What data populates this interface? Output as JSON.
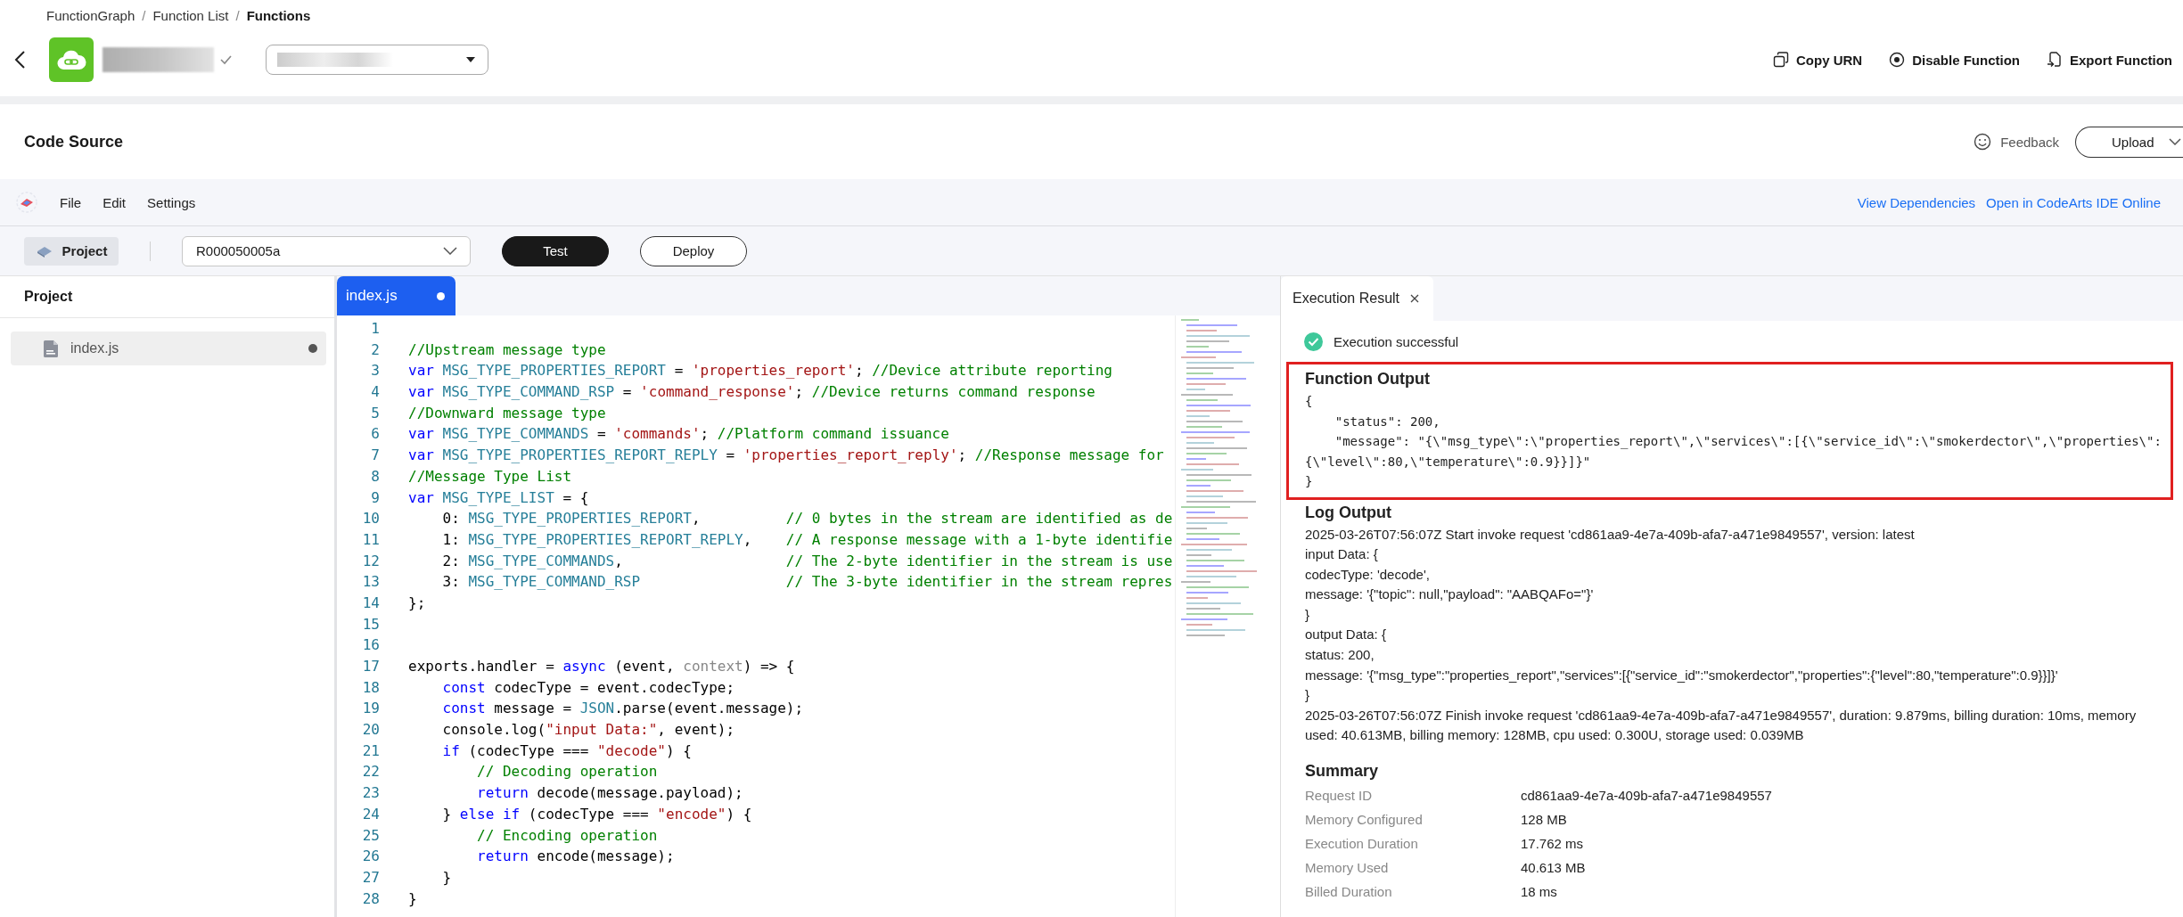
{
  "breadcrumb": {
    "items": [
      {
        "label": "FunctionGraph",
        "current": false
      },
      {
        "label": "Function List",
        "current": false
      },
      {
        "label": "Functions",
        "current": true
      }
    ],
    "separators": [
      "/",
      "/"
    ]
  },
  "header": {
    "actions": [
      {
        "label": "Copy URN"
      },
      {
        "label": "Disable Function"
      },
      {
        "label": "Export Function"
      }
    ]
  },
  "code_source": {
    "title": "Code Source",
    "feedback": "Feedback",
    "upload": "Upload"
  },
  "ide_menu": {
    "items": [
      "File",
      "Edit",
      "Settings"
    ],
    "links": [
      "View Dependencies",
      "Open in CodeArts IDE Online"
    ]
  },
  "toolbar": {
    "project_button": "Project",
    "select_value": "R000050005a",
    "buttons": [
      {
        "label": "Test",
        "kind": "primary"
      },
      {
        "label": "Deploy",
        "kind": "secondary"
      }
    ]
  },
  "project_panel": {
    "title": "Project",
    "files": [
      {
        "name": "index.js",
        "modified": true,
        "selected": true
      }
    ]
  },
  "editor": {
    "tabs": [
      {
        "label": "index.js",
        "modified": true,
        "selected": true
      }
    ],
    "lines": [
      {
        "number": "1"
      },
      {
        "number": "2",
        "tokens": [
          {
            "kind": "comment",
            "text": "//Upstream message type"
          }
        ]
      },
      {
        "number": "3",
        "tokens": [
          {
            "kind": "keyword",
            "text": "var"
          },
          {
            "kind": "constant",
            "text": " MSG_TYPE_PROPERTIES_REPORT"
          },
          {
            "kind": "plain",
            "text": " = "
          },
          {
            "kind": "string",
            "text": "'properties_report'"
          },
          {
            "kind": "plain",
            "text": "; "
          },
          {
            "kind": "comment",
            "text": "//Device attribute reporting"
          }
        ]
      },
      {
        "number": "4",
        "tokens": [
          {
            "kind": "keyword",
            "text": "var"
          },
          {
            "kind": "constant",
            "text": " MSG_TYPE_COMMAND_RSP"
          },
          {
            "kind": "plain",
            "text": " = "
          },
          {
            "kind": "string",
            "text": "'command_response'"
          },
          {
            "kind": "plain",
            "text": "; "
          },
          {
            "kind": "comment",
            "text": "//Device returns command response"
          }
        ]
      },
      {
        "number": "5",
        "tokens": [
          {
            "kind": "comment",
            "text": "//Downward message type"
          }
        ]
      },
      {
        "number": "6",
        "tokens": [
          {
            "kind": "keyword",
            "text": "var"
          },
          {
            "kind": "constant",
            "text": " MSG_TYPE_COMMANDS"
          },
          {
            "kind": "plain",
            "text": " = "
          },
          {
            "kind": "string",
            "text": "'commands'"
          },
          {
            "kind": "plain",
            "text": "; "
          },
          {
            "kind": "comment",
            "text": "//Platform command issuance"
          }
        ]
      },
      {
        "number": "7",
        "tokens": [
          {
            "kind": "keyword",
            "text": "var"
          },
          {
            "kind": "constant",
            "text": " MSG_TYPE_PROPERTIES_REPORT_REPLY"
          },
          {
            "kind": "plain",
            "text": " = "
          },
          {
            "kind": "string",
            "text": "'properties_report_reply'"
          },
          {
            "kind": "plain",
            "text": "; "
          },
          {
            "kind": "comment",
            "text": "//Response message for"
          }
        ]
      },
      {
        "number": "8",
        "tokens": [
          {
            "kind": "comment",
            "text": "//Message Type List"
          }
        ]
      },
      {
        "number": "9",
        "tokens": [
          {
            "kind": "keyword",
            "text": "var"
          },
          {
            "kind": "constant",
            "text": " MSG_TYPE_LIST"
          },
          {
            "kind": "plain",
            "text": " = {"
          }
        ]
      },
      {
        "number": "10",
        "tokens": [
          {
            "kind": "plain",
            "text": "    0: "
          },
          {
            "kind": "constant",
            "text": "MSG_TYPE_PROPERTIES_REPORT"
          },
          {
            "kind": "plain",
            "text": ",          "
          },
          {
            "kind": "comment",
            "text": "// 0 bytes in the stream are identified as de"
          }
        ]
      },
      {
        "number": "11",
        "tokens": [
          {
            "kind": "plain",
            "text": "    1: "
          },
          {
            "kind": "constant",
            "text": "MSG_TYPE_PROPERTIES_REPORT_REPLY"
          },
          {
            "kind": "plain",
            "text": ",    "
          },
          {
            "kind": "comment",
            "text": "// A response message with a 1-byte identifie"
          }
        ]
      },
      {
        "number": "12",
        "tokens": [
          {
            "kind": "plain",
            "text": "    2: "
          },
          {
            "kind": "constant",
            "text": "MSG_TYPE_COMMANDS"
          },
          {
            "kind": "plain",
            "text": ",                   "
          },
          {
            "kind": "comment",
            "text": "// The 2-byte identifier in the stream is use"
          }
        ]
      },
      {
        "number": "13",
        "tokens": [
          {
            "kind": "plain",
            "text": "    3: "
          },
          {
            "kind": "constant",
            "text": "MSG_TYPE_COMMAND_RSP"
          },
          {
            "kind": "comment",
            "text": "                 // The 3-byte identifier in the stream repres"
          }
        ]
      },
      {
        "number": "14",
        "tokens": [
          {
            "kind": "plain",
            "text": "};"
          }
        ]
      },
      {
        "number": "15"
      },
      {
        "number": "16"
      },
      {
        "number": "17",
        "tokens": [
          {
            "kind": "plain",
            "text": "exports.handler = "
          },
          {
            "kind": "keyword",
            "text": "async"
          },
          {
            "kind": "plain",
            "text": " (event, "
          },
          {
            "kind": "muted",
            "text": "context"
          },
          {
            "kind": "plain",
            "text": ") => {"
          }
        ]
      },
      {
        "number": "18",
        "tokens": [
          {
            "kind": "keyword",
            "text": "    const"
          },
          {
            "kind": "plain",
            "text": " codecType = event.codecType;"
          }
        ]
      },
      {
        "number": "19",
        "tokens": [
          {
            "kind": "keyword",
            "text": "    const"
          },
          {
            "kind": "plain",
            "text": " message = "
          },
          {
            "kind": "constant",
            "text": "JSON"
          },
          {
            "kind": "plain",
            "text": ".parse(event.message);"
          }
        ]
      },
      {
        "number": "20",
        "tokens": [
          {
            "kind": "plain",
            "text": "    console.log("
          },
          {
            "kind": "string",
            "text": "\"input Data:\""
          },
          {
            "kind": "plain",
            "text": ", event);"
          }
        ]
      },
      {
        "number": "21",
        "tokens": [
          {
            "kind": "keyword",
            "text": "    if"
          },
          {
            "kind": "plain",
            "text": " (codecType === "
          },
          {
            "kind": "string",
            "text": "\"decode\""
          },
          {
            "kind": "plain",
            "text": ") {"
          }
        ]
      },
      {
        "number": "22",
        "tokens": [
          {
            "kind": "comment",
            "text": "        // Decoding operation"
          }
        ]
      },
      {
        "number": "23",
        "tokens": [
          {
            "kind": "keyword",
            "text": "        return"
          },
          {
            "kind": "plain",
            "text": " decode(message.payload);"
          }
        ]
      },
      {
        "number": "24",
        "tokens": [
          {
            "kind": "plain",
            "text": "    } "
          },
          {
            "kind": "keyword",
            "text": "else if"
          },
          {
            "kind": "plain",
            "text": " (codecType === "
          },
          {
            "kind": "string",
            "text": "\"encode\""
          },
          {
            "kind": "plain",
            "text": ") {"
          }
        ]
      },
      {
        "number": "25",
        "tokens": [
          {
            "kind": "comment",
            "text": "        // Encoding operation"
          }
        ]
      },
      {
        "number": "26",
        "tokens": [
          {
            "kind": "keyword",
            "text": "        return"
          },
          {
            "kind": "plain",
            "text": " encode(message);"
          }
        ]
      },
      {
        "number": "27",
        "tokens": [
          {
            "kind": "plain",
            "text": "    }"
          }
        ]
      },
      {
        "number": "28",
        "tokens": [
          {
            "kind": "plain",
            "text": "}"
          }
        ]
      }
    ]
  },
  "result": {
    "tabs": [
      {
        "label": "Execution Result",
        "selected": true
      }
    ],
    "status": "Execution successful",
    "function_output": {
      "title": "Function Output",
      "highlighted": true,
      "lines": [
        "{",
        "    \"status\": 200,",
        "    \"message\": \"{\\\"msg_type\\\":\\\"properties_report\\\",\\\"services\\\":[{\\\"service_id\\\":\\\"smokerdector\\\",\\\"properties\\\":",
        "{\\\"level\\\":80,\\\"temperature\\\":0.9}}]}\"",
        "}"
      ]
    },
    "log_output": {
      "title": "Log Output",
      "lines": [
        "2025-03-26T07:56:07Z Start invoke request 'cd861aa9-4e7a-409b-afa7-a471e9849557', version: latest",
        "input Data: {",
        "codecType: 'decode',",
        "message: '{\"topic\": null,\"payload\": \"AABQAFo=\"}'",
        "}",
        "output Data: {",
        "status: 200,",
        "message: '{\"msg_type\":\"properties_report\",\"services\":[{\"service_id\":\"smokerdector\",\"properties\":{\"level\":80,\"temperature\":0.9}}]}'",
        "}",
        "2025-03-26T07:56:07Z Finish invoke request 'cd861aa9-4e7a-409b-afa7-a471e9849557', duration: 9.879ms, billing duration: 10ms, memory used: 40.613MB, billing memory: 128MB, cpu used: 0.300U, storage used: 0.039MB"
      ]
    },
    "summary": {
      "title": "Summary",
      "rows": [
        {
          "label": "Request ID",
          "value": "cd861aa9-4e7a-409b-afa7-a471e9849557"
        },
        {
          "label": "Memory Configured",
          "value": "128 MB"
        },
        {
          "label": "Execution Duration",
          "value": "17.762 ms"
        },
        {
          "label": "Memory Used",
          "value": "40.613 MB"
        },
        {
          "label": "Billed Duration",
          "value": "18 ms"
        }
      ]
    }
  }
}
